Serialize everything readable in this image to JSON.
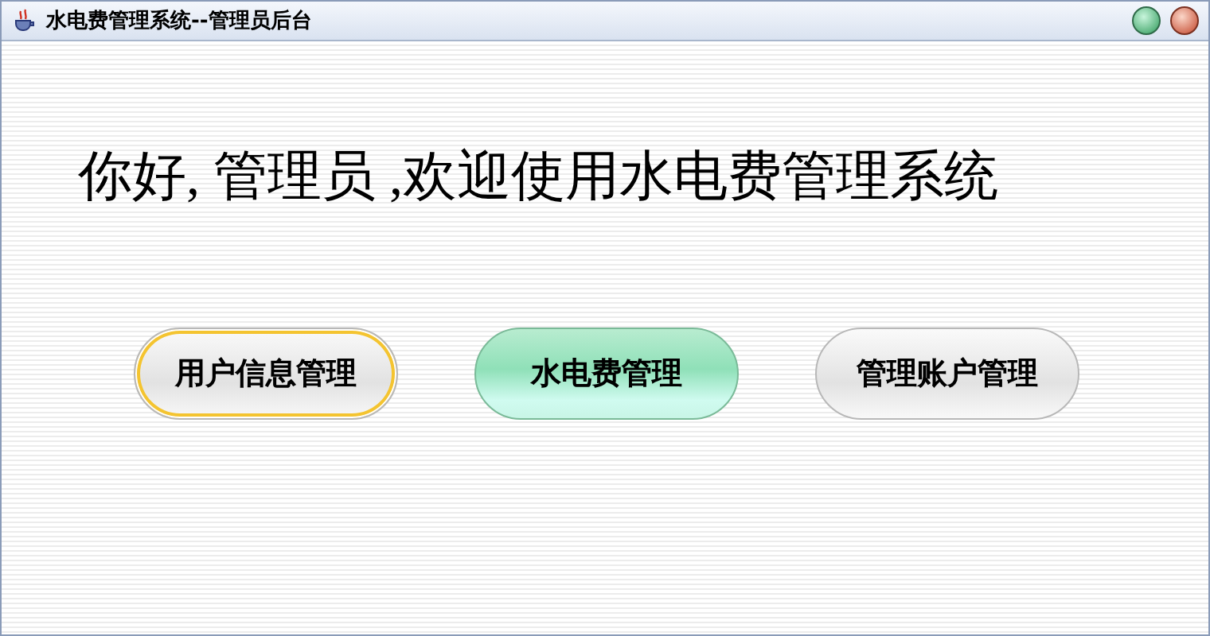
{
  "window": {
    "title": "水电费管理系统--管理员后台"
  },
  "greeting": "你好, 管理员 ,欢迎使用水电费管理系统",
  "buttons": [
    {
      "label": "用户信息管理",
      "focused": true,
      "highlighted": false
    },
    {
      "label": "水电费管理",
      "focused": false,
      "highlighted": true
    },
    {
      "label": "管理账户管理",
      "focused": false,
      "highlighted": false
    }
  ]
}
